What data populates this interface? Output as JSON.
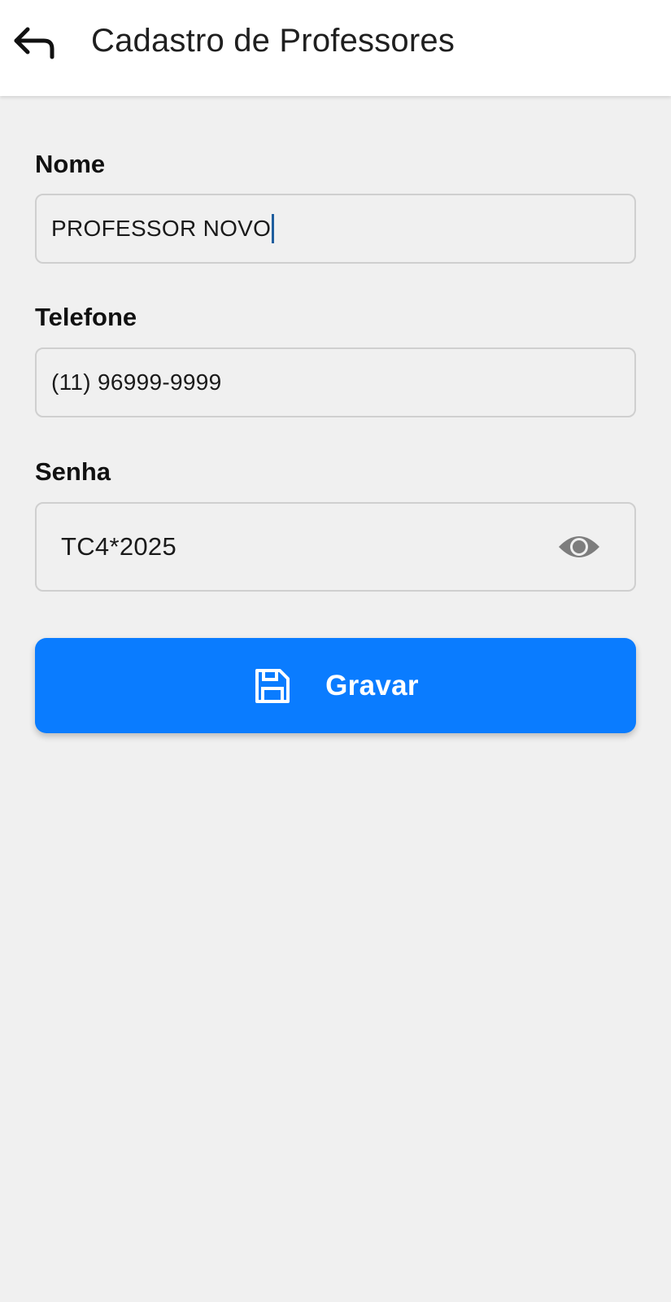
{
  "header": {
    "title": "Cadastro de Professores",
    "back_icon": "back-arrow-icon"
  },
  "form": {
    "nome": {
      "label": "Nome",
      "value": "PROFESSOR NOVO"
    },
    "telefone": {
      "label": "Telefone",
      "value": "(11) 96999-9999"
    },
    "senha": {
      "label": "Senha",
      "value": "TC4*2025",
      "toggle_icon": "eye-icon"
    },
    "save": {
      "label": "Gravar",
      "icon": "floppy-disk-icon"
    }
  },
  "colors": {
    "primary": "#0a7cff",
    "background": "#f0f0f0",
    "header_bg": "#ffffff",
    "caret": "#1f5e9e"
  }
}
